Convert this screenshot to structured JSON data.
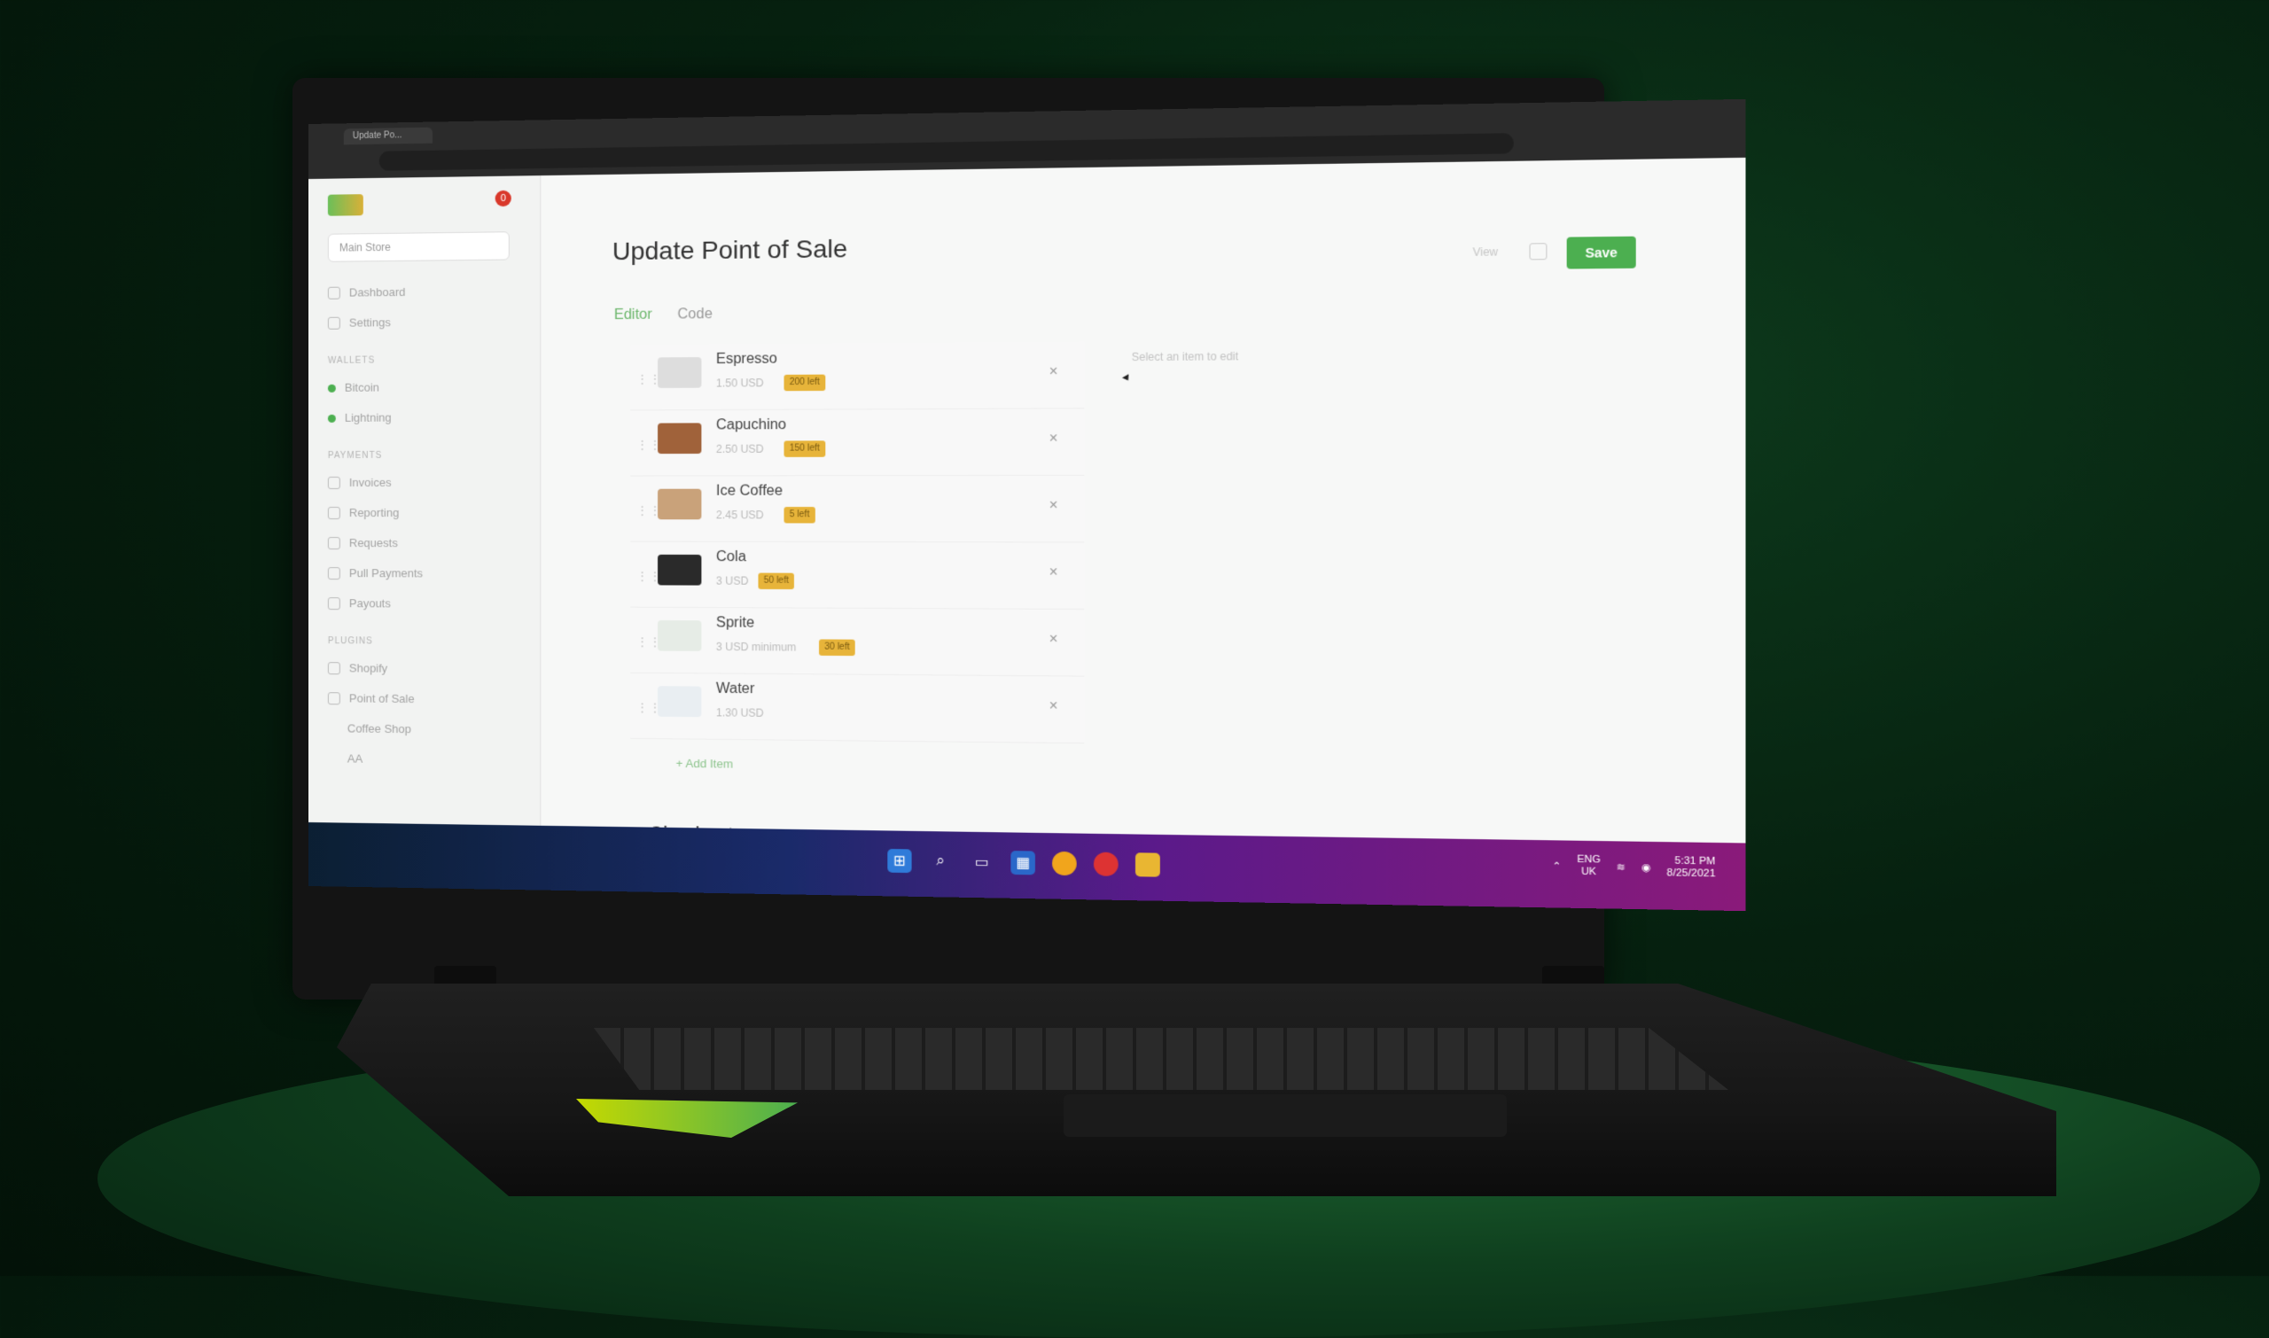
{
  "browser": {
    "tab_title": "Update Po..."
  },
  "sidebar": {
    "notification_count": "0",
    "store": "Main Store",
    "items": [
      {
        "label": "Dashboard"
      },
      {
        "label": "Settings"
      }
    ],
    "wallets_title": "WALLETS",
    "wallets": [
      {
        "label": "Bitcoin"
      },
      {
        "label": "Lightning"
      }
    ],
    "payments_title": "PAYMENTS",
    "payments": [
      {
        "label": "Invoices"
      },
      {
        "label": "Reporting"
      },
      {
        "label": "Requests"
      },
      {
        "label": "Pull Payments"
      },
      {
        "label": "Payouts"
      }
    ],
    "plugins_title": "PLUGINS",
    "plugins": [
      {
        "label": "Shopify"
      },
      {
        "label": "Point of Sale"
      },
      {
        "label": "Coffee Shop"
      },
      {
        "label": "AA"
      }
    ]
  },
  "main": {
    "title": "Update Point of Sale",
    "view_label": "View",
    "save_label": "Save",
    "tabs": {
      "editor": "Editor",
      "code": "Code"
    },
    "hint": "Select an item to edit",
    "add_item": "+ Add Item",
    "checkout": "Checkout",
    "items": [
      {
        "name": "Espresso",
        "price": "1.50 USD",
        "stock": "200 left"
      },
      {
        "name": "Capuchino",
        "price": "2.50 USD",
        "stock": "150 left"
      },
      {
        "name": "Ice Coffee",
        "price": "2.45 USD",
        "stock": "5 left"
      },
      {
        "name": "Cola",
        "price": "3 USD",
        "stock": "50 left"
      },
      {
        "name": "Sprite",
        "price": "3 USD minimum",
        "stock": "30 left"
      },
      {
        "name": "Water",
        "price": "1.30 USD",
        "stock": ""
      }
    ]
  },
  "taskbar": {
    "lang_top": "ENG",
    "lang_bottom": "UK",
    "time": "5:31 PM",
    "date": "8/25/2021"
  },
  "colors": {
    "accent": "#4caf50",
    "stock_badge": "#e7b43a"
  }
}
